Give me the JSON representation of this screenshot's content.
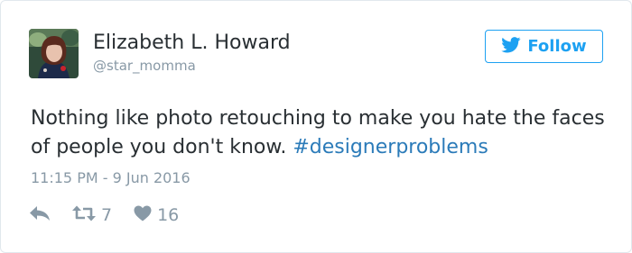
{
  "user": {
    "name": "Elizabeth L. Howard",
    "handle": "@star_momma",
    "avatar_icon": "profile-photo"
  },
  "follow_button": {
    "label": "Follow",
    "icon": "twitter-bird-icon",
    "color": "#1da1f2"
  },
  "tweet": {
    "text": "Nothing like photo retouching to make you hate the faces of people you don't know. ",
    "hashtag": "#designerproblems",
    "timestamp": "11:15 PM - 9 Jun 2016"
  },
  "actions": {
    "reply_icon": "reply-icon",
    "retweet_icon": "retweet-icon",
    "retweet_count": "7",
    "like_icon": "heart-icon",
    "like_count": "16"
  },
  "colors": {
    "text": "#292f33",
    "muted": "#8899a6",
    "link": "#2b7bb9",
    "brand": "#1da1f2"
  }
}
